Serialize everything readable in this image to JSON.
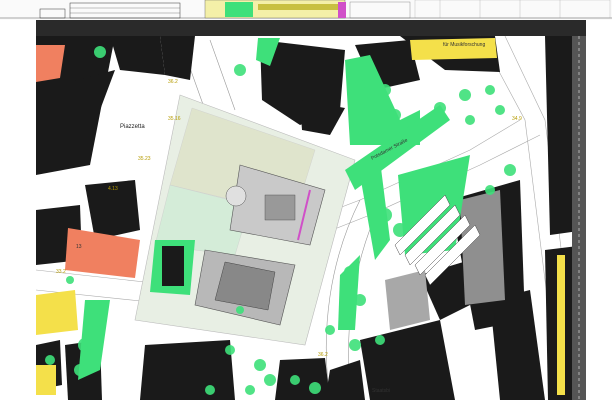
{
  "labels": {
    "piazzetta": "Piazzetta",
    "musikforschung": "für Musikforschung",
    "potsdamer_strasse": "Potsdamer Straße",
    "staatsbibliothek": "Staatsbi",
    "elev_1": "36.2",
    "elev_2": "35.16",
    "elev_3": "35.23",
    "elev_4": "4.13",
    "elev_5": "36.2",
    "elev_6": "34.9",
    "elev_7": "33.2",
    "num_13": "13"
  },
  "colors": {
    "building_existing": "#1a1a1a",
    "landscape_green": "#3ee07a",
    "accent_orange": "#f08060",
    "accent_yellow": "#f4e04a",
    "plaza": "#e4ede0",
    "road": "#f1f1f1"
  }
}
